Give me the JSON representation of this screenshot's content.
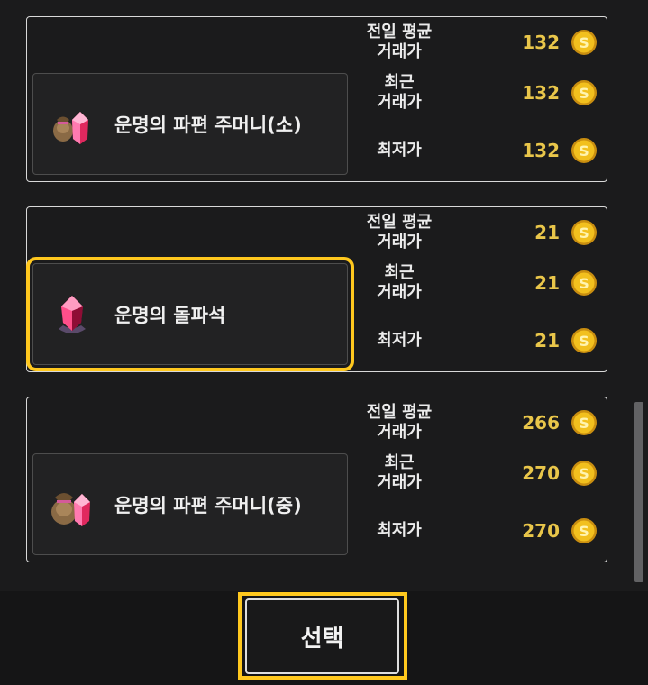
{
  "items": [
    {
      "name": "운명의 파편 주머니(소)",
      "icon": "pouch-with-gem-icon",
      "selected": false,
      "prices": [
        {
          "label_line1": "전일 평균",
          "label_line2": "거래가",
          "value": "132"
        },
        {
          "label_line1": "최근",
          "label_line2": "거래가",
          "value": "132"
        },
        {
          "label_line1": "최저가",
          "label_line2": "",
          "value": "132"
        }
      ]
    },
    {
      "name": "운명의 돌파석",
      "icon": "red-crystal-icon",
      "selected": true,
      "prices": [
        {
          "label_line1": "전일 평균",
          "label_line2": "거래가",
          "value": "21"
        },
        {
          "label_line1": "최근",
          "label_line2": "거래가",
          "value": "21"
        },
        {
          "label_line1": "최저가",
          "label_line2": "",
          "value": "21"
        }
      ]
    },
    {
      "name": "운명의 파편 주머니(중)",
      "icon": "large-pouch-with-gem-icon",
      "selected": false,
      "prices": [
        {
          "label_line1": "전일 평균",
          "label_line2": "거래가",
          "value": "266"
        },
        {
          "label_line1": "최근",
          "label_line2": "거래가",
          "value": "270"
        },
        {
          "label_line1": "최저가",
          "label_line2": "",
          "value": "270"
        }
      ]
    }
  ],
  "currency_icon": "gold-coin-icon",
  "select_button_label": "선택",
  "colors": {
    "highlight": "#ffc81e",
    "price": "#e9c64a",
    "background": "#1b1b1c"
  }
}
